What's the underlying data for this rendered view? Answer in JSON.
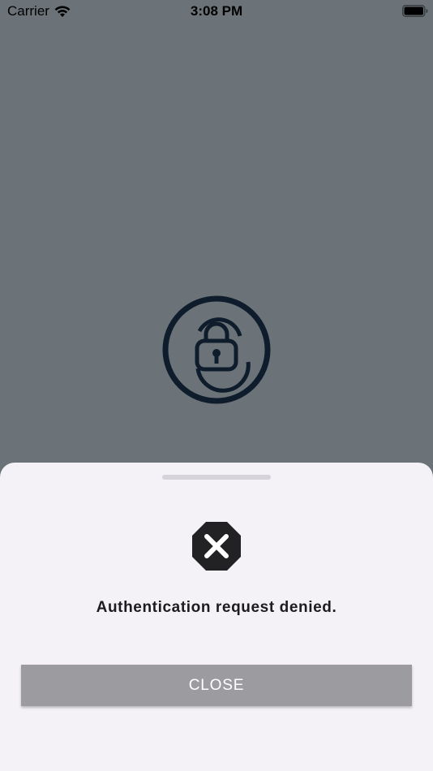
{
  "status_bar": {
    "carrier": "Carrier",
    "time": "3:08 PM",
    "icons": [
      "wifi-icon",
      "battery-icon"
    ]
  },
  "app": {
    "logo_icon": "lock-in-circle-logo",
    "logo_color": "#0e1c2c"
  },
  "sheet": {
    "error_icon": "x-octagon-icon",
    "message": "Authentication request denied.",
    "close_label": "CLOSE"
  },
  "colors": {
    "background": "#6b7378",
    "sheet_background": "#f4f1f7",
    "button_background": "#9c9ba0",
    "button_text": "#ffffff"
  }
}
